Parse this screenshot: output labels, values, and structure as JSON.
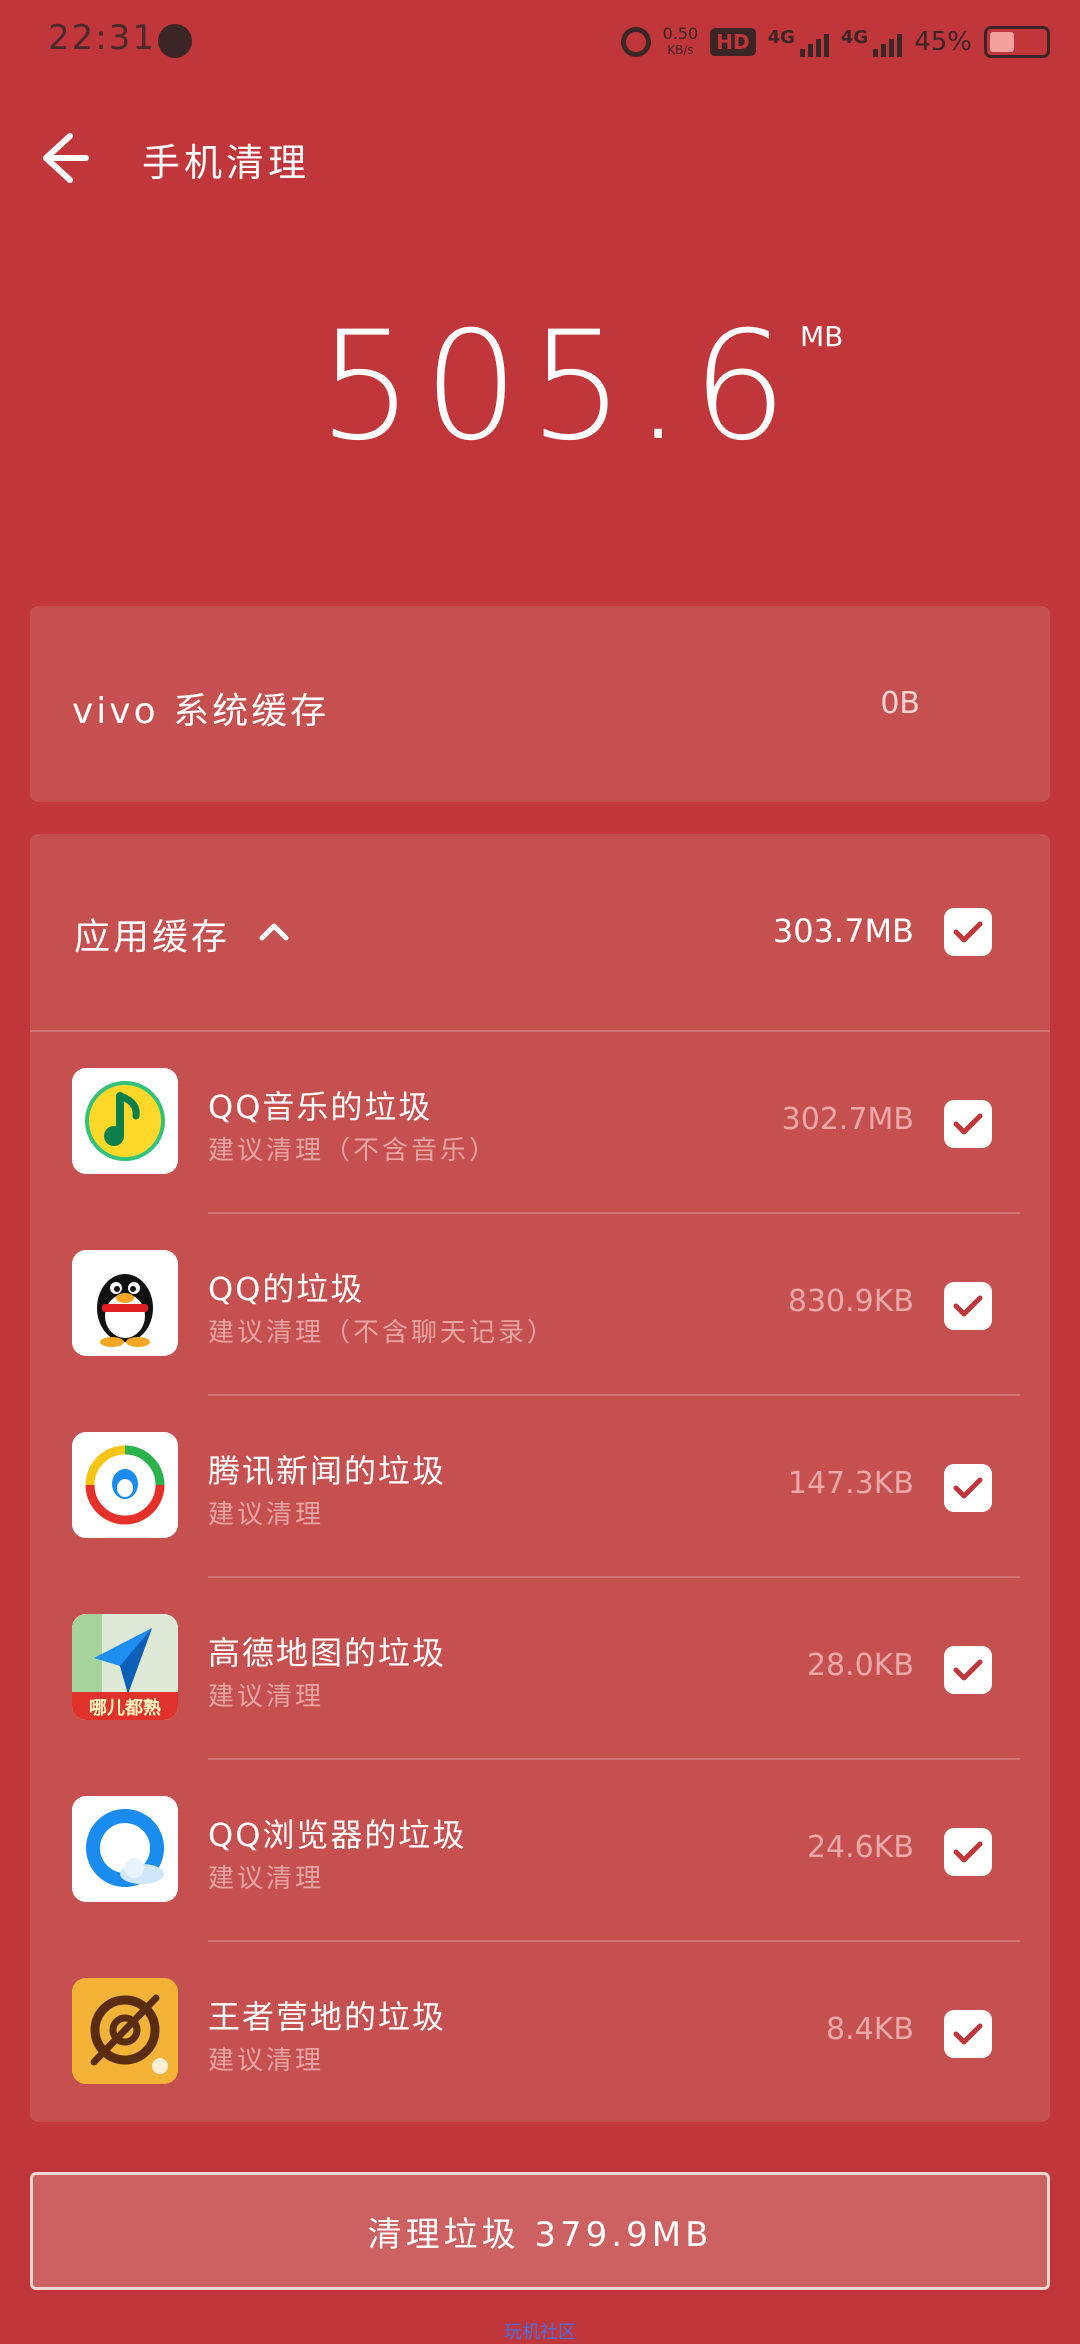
{
  "status": {
    "time": "22:31",
    "speed_value": "0.50",
    "speed_unit": "KB/s",
    "hd": "HD",
    "sim1": "4G",
    "sim2": "4G",
    "battery_pct": "45%",
    "battery_level": 0.45
  },
  "header": {
    "title": "手机清理"
  },
  "summary": {
    "value": "505.6",
    "unit": "MB"
  },
  "system_cache": {
    "label": "vivo 系统缓存",
    "size": "0B"
  },
  "app_cache": {
    "label": "应用缓存",
    "total": "303.7MB",
    "items": [
      {
        "name": "QQ音乐的垃圾",
        "sub": "建议清理（不含音乐）",
        "size": "302.7MB",
        "icon": "qq-music-icon"
      },
      {
        "name": "QQ的垃圾",
        "sub": "建议清理（不含聊天记录）",
        "size": "830.9KB",
        "icon": "qq-penguin-icon"
      },
      {
        "name": "腾讯新闻的垃圾",
        "sub": "建议清理",
        "size": "147.3KB",
        "icon": "tencent-news-icon"
      },
      {
        "name": "高德地图的垃圾",
        "sub": "建议清理",
        "size": "28.0KB",
        "icon": "amap-icon",
        "icon_badge": "哪儿都熟"
      },
      {
        "name": "QQ浏览器的垃圾",
        "sub": "建议清理",
        "size": "24.6KB",
        "icon": "qq-browser-icon"
      },
      {
        "name": "王者营地的垃圾",
        "sub": "建议清理",
        "size": "8.4KB",
        "icon": "wangzhe-camp-icon"
      }
    ]
  },
  "action": {
    "clean_label": "清理垃圾  379.9MB"
  },
  "watermark": "玩机社区",
  "colors": {
    "background": "#c1363a",
    "card": "#c6504f",
    "button": "#cd6061"
  }
}
